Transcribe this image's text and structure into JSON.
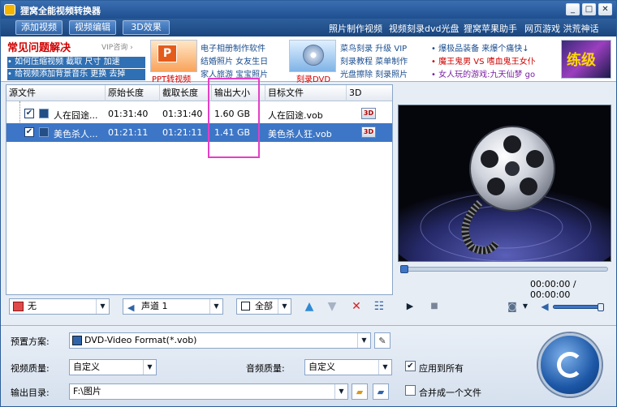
{
  "window": {
    "title": "狸窝全能视频转换器",
    "min": "_",
    "max": "□",
    "close": "✕"
  },
  "menu": {
    "buttons": [
      "添加视频",
      "视频编辑",
      "3D效果"
    ],
    "links": [
      "照片制作视频",
      "视频刻录dvd光盘",
      "狸窝苹果助手",
      "网页游戏 洪荒神话"
    ]
  },
  "ads": {
    "faq_title": "常见问题解决",
    "vip": "VIP咨询 ›",
    "faq_rows": [
      "• 如何压缩视频 截取 尺寸 加速",
      "• 给视频添加背景音乐 更换 去掉"
    ],
    "ppt_caption": "PPT转视频",
    "col1": [
      "电子相册制作软件",
      "结婚照片 女友生日",
      "家人旅游 宝宝照片"
    ],
    "dvd_caption": "刻录DVD",
    "col2": [
      "菜鸟刻录 升级 VIP",
      "刻录教程 菜单制作",
      "光盘擦除 刻录照片"
    ],
    "col3": [
      "• 爆极品装备 来爆个痛快↓",
      "• 魔王鬼男 VS 嗜血鬼王女仆",
      "• 女人玩的游戏:九天仙梦 go"
    ],
    "game_badge": "练级"
  },
  "table": {
    "headers": [
      "源文件",
      "原始长度",
      "截取长度",
      "输出大小",
      "目标文件",
      "3D"
    ],
    "rows": [
      {
        "name": "人在囧途...",
        "orig": "01:31:40",
        "cut": "01:31:40",
        "size": "1.60 GB",
        "target": "人在囧途.vob",
        "check": "✔",
        "badge": "3D"
      },
      {
        "name": "美色杀人...",
        "orig": "01:21:11",
        "cut": "01:21:11",
        "size": "1.41 GB",
        "target": "美色杀人狂.vob",
        "check": "✔",
        "badge": "3D"
      }
    ]
  },
  "player": {
    "time": "00:00:00 / 00:00:00",
    "progress": 0
  },
  "controls": {
    "subtitle": "无",
    "audio": "声道 1",
    "all": "全部"
  },
  "bottom": {
    "preset_label": "预置方案:",
    "preset_value": "DVD-Video Format(*.vob)",
    "vq_label": "视频质量:",
    "vq_value": "自定义",
    "aq_label": "音频质量:",
    "aq_value": "自定义",
    "apply_all": "应用到所有",
    "out_label": "输出目录:",
    "out_value": "F:\\图片",
    "merge": "合并成一个文件"
  },
  "colors": {
    "accent": "#3d76c6",
    "highlight": "#e43fc6",
    "titlebar": "#2b5e9a"
  }
}
